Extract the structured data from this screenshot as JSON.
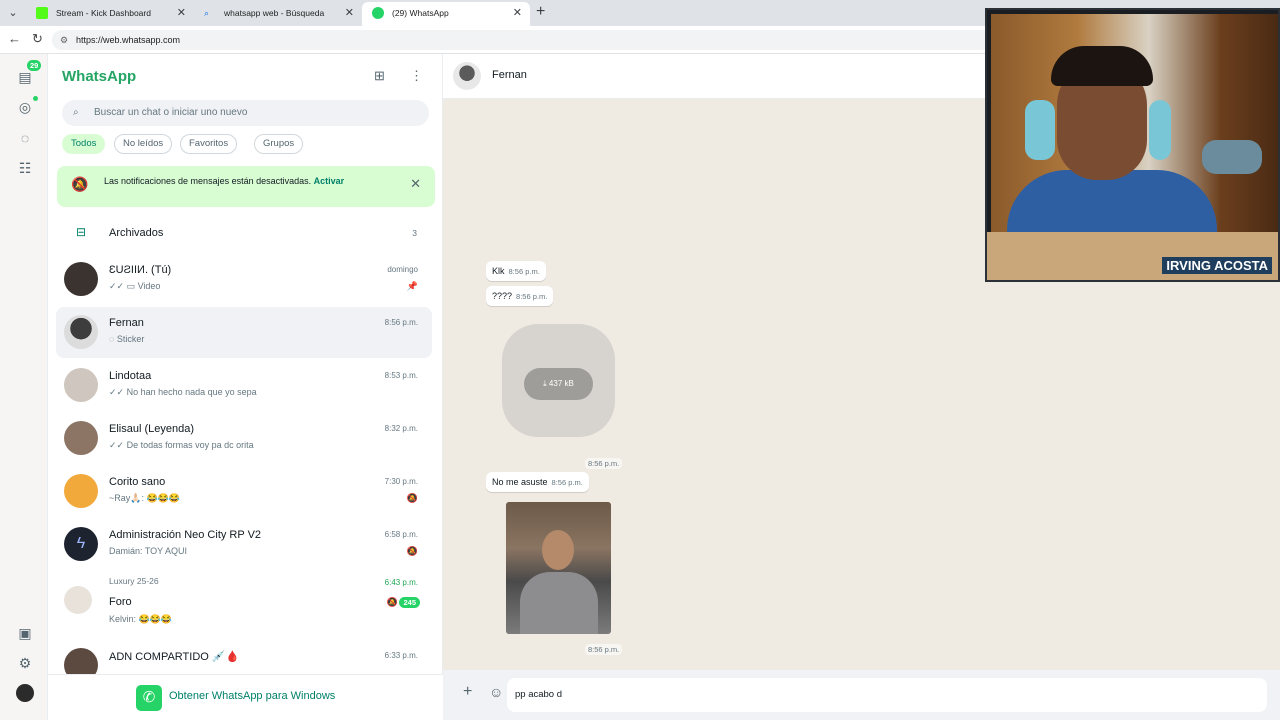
{
  "browser": {
    "tabs": [
      {
        "title": "Stream - Kick Dashboard",
        "active": false,
        "favicon_color": "#53fc18"
      },
      {
        "title": "whatsapp web - Búsqueda",
        "active": false,
        "favicon_color": "#ffffff"
      },
      {
        "title": "(29) WhatsApp",
        "active": true,
        "favicon_color": "#25d366"
      }
    ],
    "url": "https://web.whatsapp.com"
  },
  "rail": {
    "chats_badge": "29"
  },
  "sidebar": {
    "brand": "WhatsApp",
    "search_placeholder": "Buscar un chat o iniciar uno nuevo",
    "filters": [
      "Todos",
      "No leídos",
      "Favoritos",
      "Grupos"
    ],
    "notice": {
      "text": "Las notificaciones de mensajes están desactivadas.",
      "action": "Activar"
    },
    "archived": {
      "label": "Archivados",
      "count": "3"
    },
    "chats": [
      {
        "name": "ƐUƧIIИ. (Tú)",
        "preview": "✓✓ ▭ Video",
        "time": "domingo",
        "icon": "📌"
      },
      {
        "name": "Fernan",
        "preview": "◌ Sticker",
        "time": "8:56 p.m.",
        "icon": ""
      },
      {
        "name": "Lindotaa",
        "preview": "✓✓ No han hecho nada que yo sepa",
        "time": "8:53 p.m.",
        "icon": ""
      },
      {
        "name": "Elisaul (Leyenda)",
        "preview": "✓✓ De todas formas voy pa dc orita",
        "time": "8:32 p.m.",
        "icon": ""
      },
      {
        "name": "Corito sano",
        "preview": "~Ray🙏🏻: 😂😂😂",
        "time": "7:30 p.m.",
        "icon": "🔕"
      },
      {
        "name": "Administración Neo City RP V2",
        "preview": "Damián: TOY AQUI",
        "time": "6:58 p.m.",
        "icon": "🔕"
      },
      {
        "community": "Luxury 25-26",
        "name": "Foro",
        "preview": "Kelvin: 😂😂😂",
        "time": "6:43 p.m.",
        "unread": "245",
        "icon": "🔕"
      },
      {
        "name": "ADN COMPARTIDO 💉🩸",
        "preview": "",
        "time": "6:33 p.m.",
        "icon": ""
      }
    ],
    "get_app": "Obtener WhatsApp para Windows"
  },
  "conversation": {
    "contact": "Fernan",
    "messages": [
      {
        "text": "Klk",
        "time": "8:56 p.m."
      },
      {
        "text": "????",
        "time": "8:56 p.m."
      },
      {
        "sticker_size": "437 kB",
        "time": "8:56 p.m."
      },
      {
        "text": "No me asuste",
        "time": "8:56 p.m."
      },
      {
        "photo": true,
        "time": "8:56 p.m."
      }
    ],
    "draft": "pp acabo d"
  },
  "webcam": {
    "name": "IRVING ACOSTA"
  }
}
